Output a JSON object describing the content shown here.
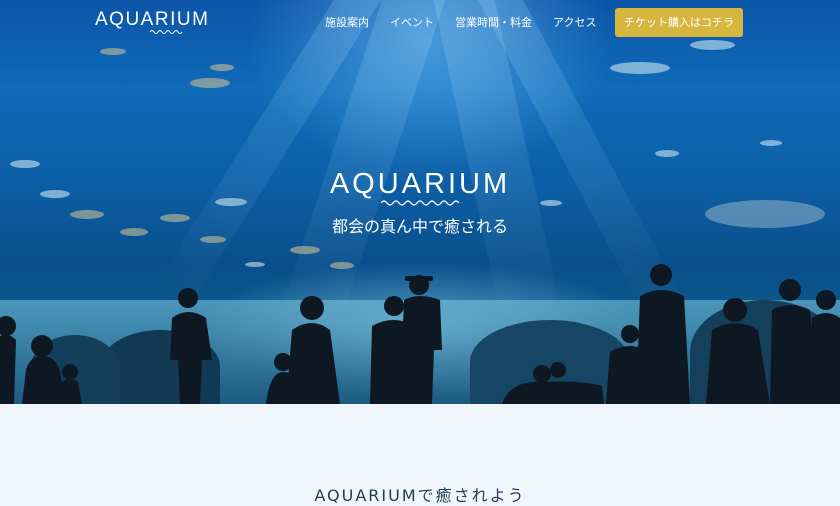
{
  "header": {
    "logo_text": "AQUARIUM",
    "nav": [
      {
        "label": "施設案内"
      },
      {
        "label": "イベント"
      },
      {
        "label": "営業時間・料金"
      },
      {
        "label": "アクセス"
      }
    ],
    "cta_label": "チケット購入はコチラ"
  },
  "hero": {
    "title": "AQUARIUM",
    "subtitle": "都会の真ん中で癒される"
  },
  "intro": {
    "heading": "AQUARIUMで癒されよう"
  },
  "colors": {
    "cta_background": "#d7b63f",
    "section_background": "#f0f6fb",
    "heading_text": "#1f3a5c"
  }
}
